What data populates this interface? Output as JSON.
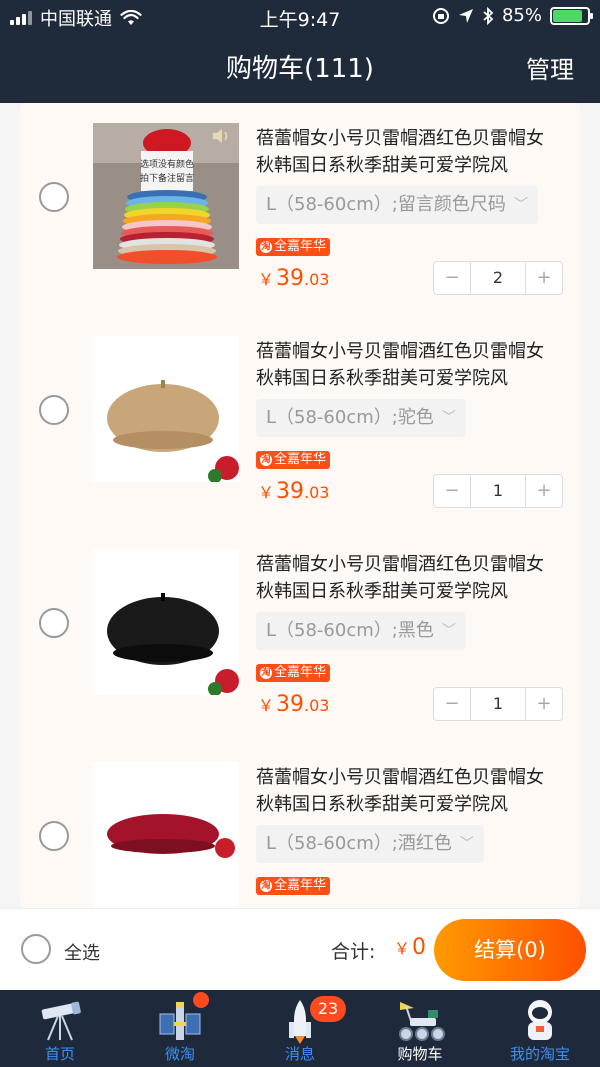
{
  "status": {
    "carrier": "中国联通",
    "time": "上午9:47",
    "battery": "85%",
    "battery_level": 0.85
  },
  "header": {
    "title": "购物车(111)",
    "manage": "管理"
  },
  "items": [
    {
      "title": "蓓蕾帽女小号贝雷帽酒红色贝雷帽女秋韩国日系秋季甜美可爱学院风",
      "sku": "L（58-60cm）;留言颜色尺码",
      "badge": "全嘉年华",
      "currency": "￥",
      "price_int": "39",
      "price_dec": ".03",
      "qty": "2",
      "minus": "−",
      "plus": "+",
      "thumb_note": "选项没有颜色\n拍下备注留言",
      "hat_color": "#c8102e"
    },
    {
      "title": "蓓蕾帽女小号贝雷帽酒红色贝雷帽女秋韩国日系秋季甜美可爱学院风",
      "sku": "L（58-60cm）;驼色",
      "badge": "全嘉年华",
      "currency": "￥",
      "price_int": "39",
      "price_dec": ".03",
      "qty": "1",
      "minus": "−",
      "plus": "+",
      "hat_color": "#c9a67a"
    },
    {
      "title": "蓓蕾帽女小号贝雷帽酒红色贝雷帽女秋韩国日系秋季甜美可爱学院风",
      "sku": "L（58-60cm）;黑色",
      "badge": "全嘉年华",
      "currency": "￥",
      "price_int": "39",
      "price_dec": ".03",
      "qty": "1",
      "minus": "−",
      "plus": "+",
      "hat_color": "#1a1a1a"
    },
    {
      "title": "蓓蕾帽女小号贝雷帽酒红色贝雷帽女秋韩国日系秋季甜美可爱学院风",
      "sku": "L（58-60cm）;酒红色",
      "badge": "全嘉年华",
      "hat_color": "#a3142a"
    }
  ],
  "checkout": {
    "select_all": "全选",
    "total_label": "合计:",
    "currency": "￥",
    "total": "0",
    "button": "结算(0)"
  },
  "tabs": [
    {
      "label": "首页",
      "icon": "telescope-icon"
    },
    {
      "label": "微淘",
      "icon": "satellite-icon"
    },
    {
      "label": "消息",
      "icon": "rocket-icon",
      "badge": "23"
    },
    {
      "label": "购物车",
      "icon": "rover-icon",
      "active": true
    },
    {
      "label": "我的淘宝",
      "icon": "astronaut-icon"
    }
  ],
  "colors": {
    "header_bg": "#1f2b3b",
    "accent": "#ff5000",
    "tab_inactive": "#3e8ff6"
  }
}
